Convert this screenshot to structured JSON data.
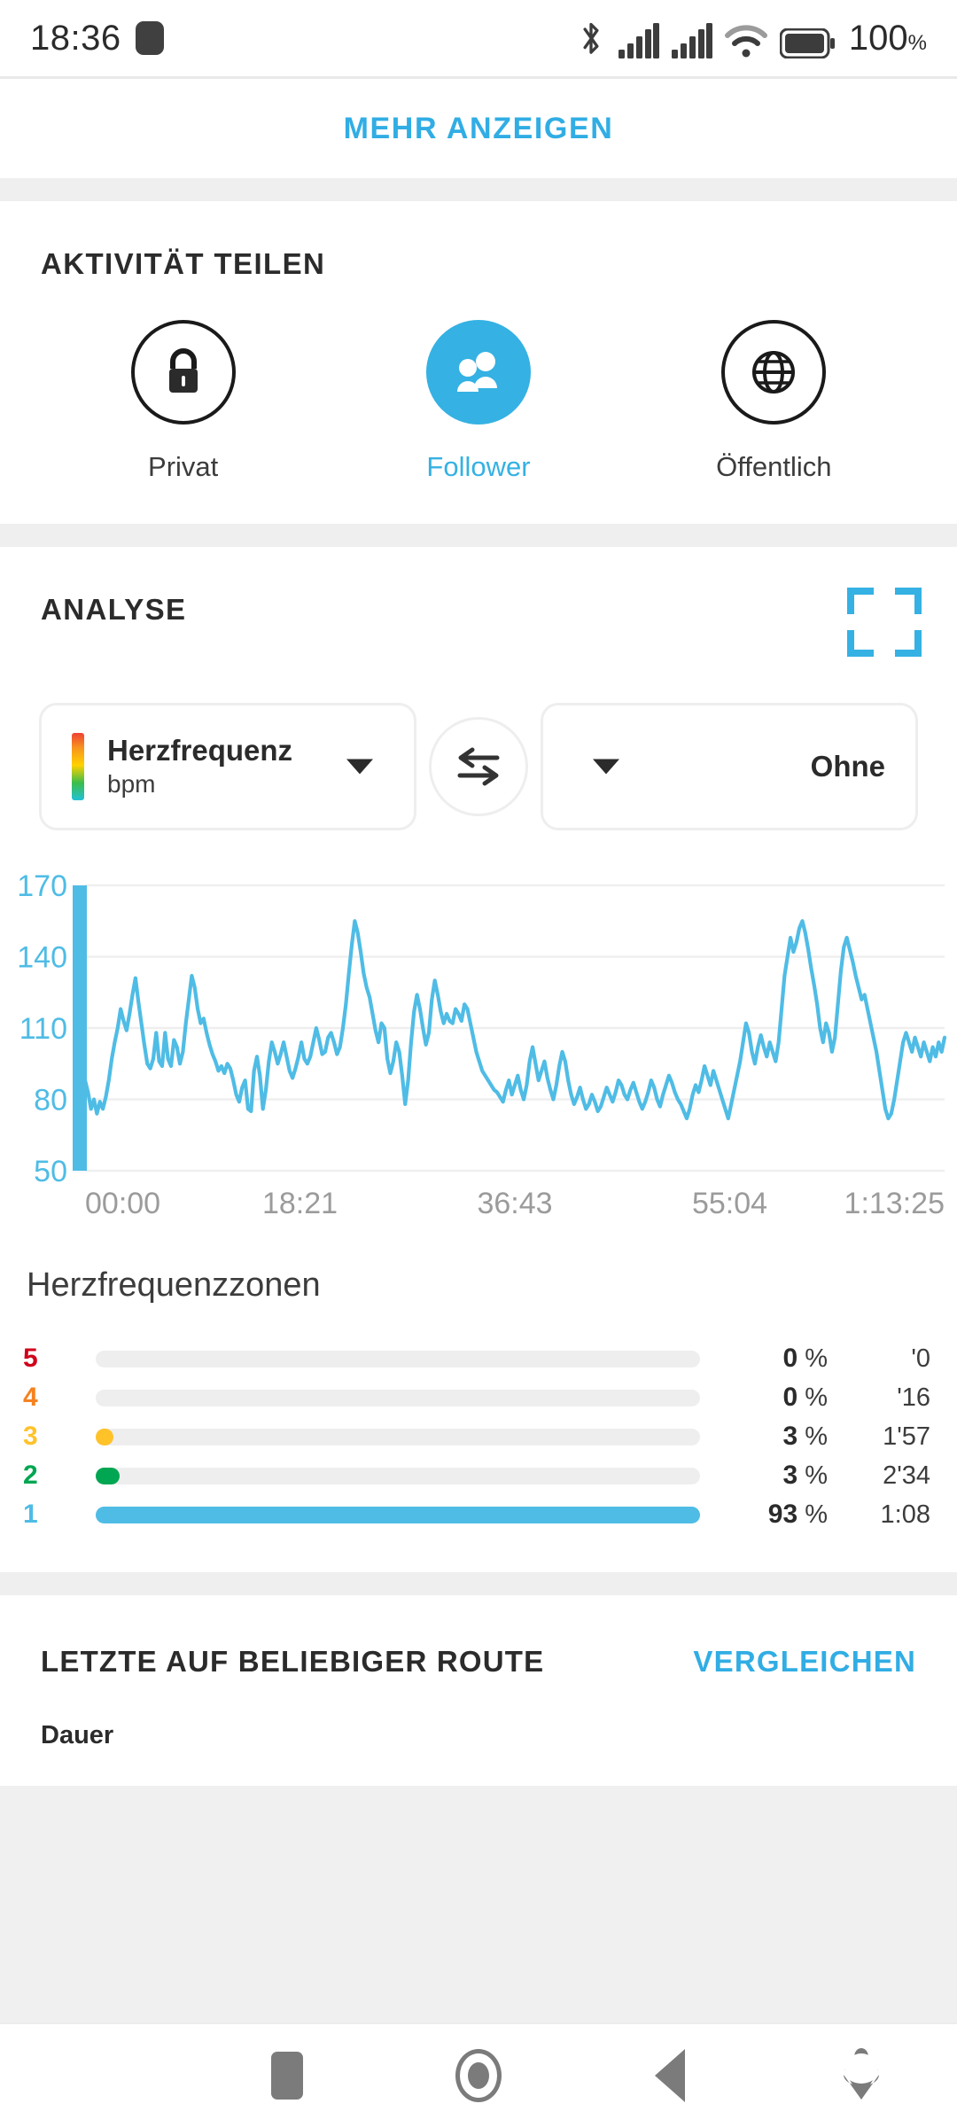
{
  "statusbar": {
    "time": "18:36",
    "battery_percent": "100",
    "percent_symbol": "%",
    "icons": [
      "bluetooth-icon",
      "signal-sim1-icon",
      "signal-sim2-icon",
      "wifi-icon",
      "battery-icon"
    ]
  },
  "show_more": {
    "label": "MEHR ANZEIGEN"
  },
  "share": {
    "title": "AKTIVITÄT TEILEN",
    "options": [
      {
        "label": "Privat",
        "icon": "lock-icon",
        "active": false
      },
      {
        "label": "Follower",
        "icon": "people-icon",
        "active": true
      },
      {
        "label": "Öffentlich",
        "icon": "globe-icon",
        "active": false
      }
    ]
  },
  "analysis": {
    "title": "ANALYSE",
    "expand_icon": "fullscreen-icon",
    "primary_metric": {
      "name": "Herzfrequenz",
      "unit": "bpm"
    },
    "secondary_metric": {
      "name": "Ohne"
    },
    "swap_icon": "swap-arrows-icon"
  },
  "zones": {
    "title": "Herzfrequenzzonen",
    "rows": [
      {
        "zone": "5",
        "color": "#D0021B",
        "percent": "0",
        "unit": "%",
        "time": "'0",
        "fill": 0
      },
      {
        "zone": "4",
        "color": "#F5821F",
        "percent": "0",
        "unit": "%",
        "time": "'16",
        "fill": 0
      },
      {
        "zone": "3",
        "color": "#FFC229",
        "percent": "3",
        "unit": "%",
        "time": "1'57",
        "fill": 3
      },
      {
        "zone": "2",
        "color": "#00A651",
        "percent": "3",
        "unit": "%",
        "time": "2'34",
        "fill": 4
      },
      {
        "zone": "1",
        "color": "#4FBCE5",
        "percent": "93",
        "unit": "%",
        "time": "1:08",
        "fill": 100
      }
    ]
  },
  "route": {
    "title": "LETZTE AUF BELIEBIGER ROUTE",
    "compare_label": "VERGLEICHEN",
    "column_label": "Dauer"
  },
  "navbar": {
    "items": [
      {
        "name": "recents-button",
        "icon": "square-icon"
      },
      {
        "name": "home-button",
        "icon": "circle-icon"
      },
      {
        "name": "back-button",
        "icon": "triangle-left-icon"
      },
      {
        "name": "collapse-button",
        "icon": "chevron-down-person-icon"
      }
    ]
  },
  "colors": {
    "accent": "#31ade4",
    "chart_line": "#4FBCE5",
    "cursor": "#4FBCE5",
    "grid": "#efefef",
    "axis_label": "#9b9b9b",
    "y_label": "#4FBCE5"
  },
  "chart_data": {
    "type": "line",
    "title": "Herzfrequenz",
    "ylabel": "bpm",
    "xlabel": "",
    "ylim": [
      50,
      170
    ],
    "yticks": [
      50,
      80,
      110,
      140,
      170
    ],
    "xticks": [
      "00:00",
      "18:21",
      "36:43",
      "55:04",
      "1:13:25"
    ],
    "xlim_seconds": [
      0,
      4405
    ],
    "grid": true,
    "legend": false,
    "cursor_x": "00:00",
    "series": [
      {
        "name": "Herzfrequenz",
        "color": "#4FBCE5",
        "values": [
          88,
          83,
          76,
          80,
          74,
          79,
          76,
          81,
          88,
          97,
          104,
          110,
          118,
          113,
          109,
          116,
          124,
          131,
          121,
          112,
          103,
          95,
          93,
          97,
          108,
          96,
          94,
          108,
          97,
          94,
          105,
          102,
          95,
          100,
          112,
          122,
          132,
          127,
          118,
          112,
          114,
          108,
          103,
          99,
          96,
          92,
          94,
          91,
          95,
          93,
          88,
          82,
          79,
          85,
          88,
          76,
          75,
          92,
          98,
          90,
          76,
          84,
          96,
          104,
          100,
          95,
          99,
          104,
          98,
          92,
          89,
          93,
          98,
          104,
          97,
          95,
          98,
          104,
          110,
          105,
          99,
          100,
          106,
          108,
          104,
          99,
          102,
          110,
          120,
          133,
          145,
          155,
          150,
          142,
          133,
          127,
          123,
          116,
          109,
          104,
          112,
          110,
          97,
          91,
          96,
          104,
          100,
          90,
          78,
          88,
          104,
          117,
          124,
          118,
          110,
          103,
          108,
          122,
          130,
          124,
          117,
          112,
          116,
          113,
          112,
          118,
          116,
          113,
          120,
          118,
          112,
          106,
          100,
          96,
          92,
          90,
          88,
          86,
          84,
          83,
          81,
          79,
          84,
          88,
          82,
          86,
          90,
          84,
          80,
          86,
          96,
          102,
          95,
          88,
          92,
          96,
          89,
          84,
          80,
          86,
          94,
          100,
          96,
          88,
          82,
          78,
          81,
          85,
          80,
          76,
          78,
          82,
          79,
          75,
          77,
          81,
          85,
          82,
          79,
          83,
          88,
          86,
          82,
          80,
          84,
          87,
          83,
          79,
          76,
          79,
          83,
          88,
          85,
          80,
          77,
          82,
          86,
          90,
          87,
          83,
          80,
          78,
          75,
          72,
          76,
          82,
          86,
          83,
          88,
          94,
          90,
          86,
          92,
          88,
          84,
          80,
          76,
          72,
          78,
          84,
          90,
          96,
          104,
          112,
          108,
          100,
          95,
          102,
          107,
          102,
          98,
          104,
          100,
          96,
          104,
          118,
          132,
          140,
          148,
          142,
          146,
          152,
          155,
          150,
          143,
          135,
          128,
          120,
          110,
          104,
          112,
          108,
          100,
          106,
          120,
          134,
          144,
          148,
          143,
          138,
          132,
          127,
          122,
          124,
          118,
          112,
          106,
          100,
          92,
          84,
          76,
          72,
          74,
          80,
          88,
          96,
          104,
          108,
          104,
          100,
          106,
          102,
          98,
          104,
          100,
          96,
          102,
          98,
          104,
          100,
          106
        ]
      }
    ]
  }
}
